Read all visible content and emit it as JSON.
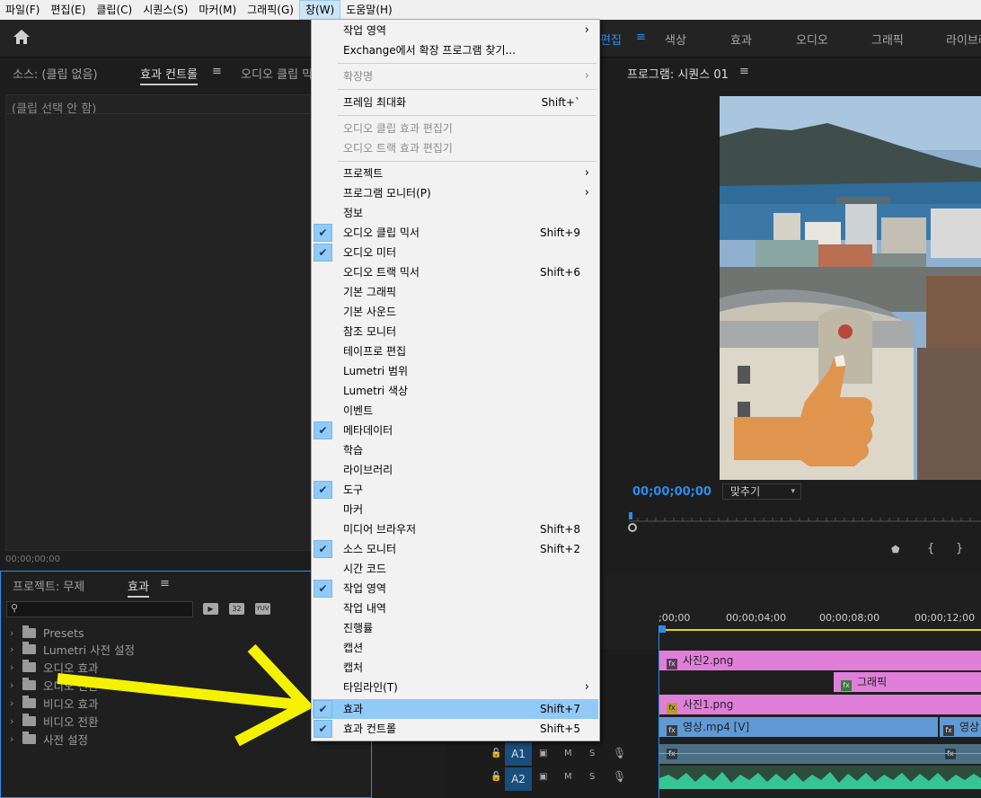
{
  "menubar": {
    "items": [
      "파일(F)",
      "편집(E)",
      "클립(C)",
      "시퀀스(S)",
      "마커(M)",
      "그래픽(G)",
      "창(W)",
      "도움말(H)"
    ]
  },
  "workspaces": [
    "편집",
    "색상",
    "효과",
    "오디오",
    "그래픽",
    "라이브러"
  ],
  "source_panel": {
    "tabs": [
      "소스: (클립 없음)",
      "효과 컨트롤",
      "오디오 클립 믹"
    ],
    "no_clip": "(클립 선택 안 함)",
    "timecode": "00;00;00;00"
  },
  "program_panel": {
    "title": "프로그램: 시퀀스 01",
    "timecode": "00;00;00;00",
    "fit": "맞추기"
  },
  "project_panel": {
    "tabs": [
      "프로젝트: 무제",
      "효과"
    ],
    "icon_labels": [
      "32",
      "YUV"
    ],
    "tree": [
      "Presets",
      "Lumetri 사전 설정",
      "오디오 효과",
      "오디오 전환",
      "비디오 효과",
      "비디오 전환",
      "사전 설정"
    ]
  },
  "dropdown": {
    "items": [
      {
        "label": "작업 영역",
        "arrow": true
      },
      {
        "label": "Exchange에서 확장 프로그램 찾기..."
      },
      {
        "label": "확장명",
        "arrow": true,
        "disabled": true
      },
      {
        "label": "프레임 최대화",
        "shortcut": "Shift+`"
      },
      {
        "label": "오디오 클립 효과 편집기",
        "disabled": true
      },
      {
        "label": "오디오 트랙 효과 편집기",
        "disabled": true
      },
      {
        "label": "프로젝트",
        "arrow": true
      },
      {
        "label": "프로그램 모니터(P)",
        "arrow": true
      },
      {
        "label": "정보"
      },
      {
        "label": "오디오 클립 믹서",
        "shortcut": "Shift+9",
        "checked": true
      },
      {
        "label": "오디오 미터",
        "checked": true
      },
      {
        "label": "오디오 트랙 믹서",
        "shortcut": "Shift+6"
      },
      {
        "label": "기본 그래픽"
      },
      {
        "label": "기본 사운드"
      },
      {
        "label": "참조 모니터"
      },
      {
        "label": "테이프로 편집"
      },
      {
        "label": "Lumetri 범위"
      },
      {
        "label": "Lumetri 색상"
      },
      {
        "label": "이벤트"
      },
      {
        "label": "메타데이터",
        "checked": true
      },
      {
        "label": "학습"
      },
      {
        "label": "라이브러리"
      },
      {
        "label": "도구",
        "checked": true
      },
      {
        "label": "마커"
      },
      {
        "label": "미디어 브라우저",
        "shortcut": "Shift+8"
      },
      {
        "label": "소스 모니터",
        "shortcut": "Shift+2",
        "checked": true
      },
      {
        "label": "시간 코드"
      },
      {
        "label": "작업 영역",
        "checked": true
      },
      {
        "label": "작업 내역"
      },
      {
        "label": "진행률"
      },
      {
        "label": "캡션"
      },
      {
        "label": "캡처"
      },
      {
        "label": "타임라인(T)",
        "arrow": true
      },
      {
        "label": "효과",
        "shortcut": "Shift+7",
        "checked": true,
        "highlighted": true
      },
      {
        "label": "효과 컨트롤",
        "shortcut": "Shift+5",
        "checked": true
      }
    ]
  },
  "timeline": {
    "ruler": [
      ";00;00",
      "00;00;04;00",
      "00;00;08;00",
      "00;00;12;00"
    ],
    "clips": {
      "photo2": "사진2.png",
      "graphic": "그래픽",
      "photo1": "사진1.png",
      "video": "영상.mp4 [V]",
      "video2": "영상"
    },
    "tracks": [
      {
        "name": "A1",
        "m": "M",
        "s": "S"
      },
      {
        "name": "A2",
        "m": "M",
        "s": "S"
      }
    ]
  },
  "colors": {
    "accent": "#2d8ceb",
    "menu_highlight": "#91c9f7",
    "clip_pink": "#e07fd9",
    "clip_blue": "#5f9ad6",
    "audio_green": "#35c496",
    "arrow_yellow": "#f5f200"
  }
}
